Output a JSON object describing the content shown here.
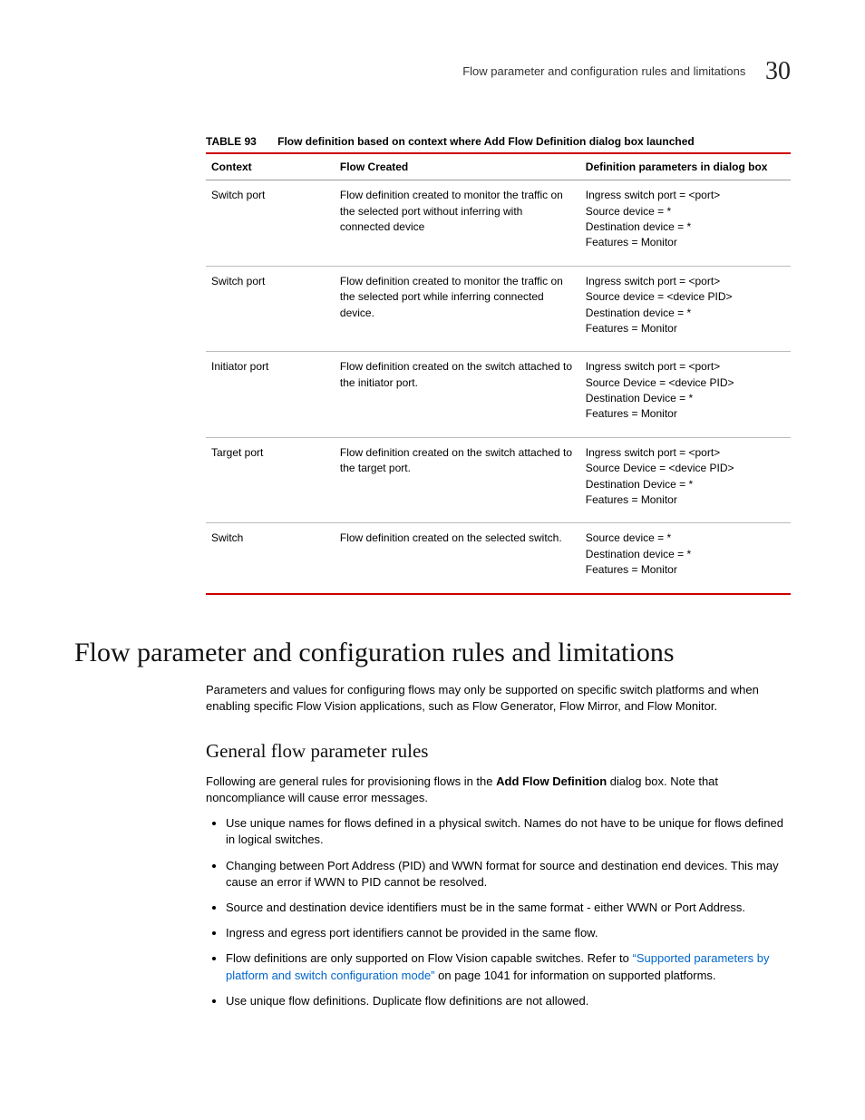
{
  "header": {
    "title": "Flow parameter and configuration rules and limitations",
    "chapnum": "30"
  },
  "table": {
    "label": "TABLE 93",
    "caption": "Flow definition based on context where Add Flow Definition dialog box launched",
    "headers": {
      "context": "Context",
      "flow": "Flow Created",
      "def": "Definition parameters in dialog box"
    },
    "rows": [
      {
        "context": "Switch port",
        "flow": "Flow definition created to monitor the traffic on the selected port without inferring with connected device",
        "def": [
          "Ingress switch port = <port>",
          "Source device = *",
          "Destination device = *",
          "Features = Monitor"
        ]
      },
      {
        "context": "Switch port",
        "flow": "Flow definition created to monitor the traffic on the selected port while inferring connected device.",
        "def": [
          "Ingress switch port = <port>",
          "Source device = <device PID>",
          "Destination device = *",
          "Features = Monitor"
        ]
      },
      {
        "context": "Initiator port",
        "flow": "Flow definition created on the switch attached to the initiator port.",
        "def": [
          "Ingress switch port = <port>",
          "Source Device = <device PID>",
          "Destination Device = *",
          "Features = Monitor"
        ]
      },
      {
        "context": "Target port",
        "flow": "Flow definition created on the switch attached to the target port.",
        "def": [
          "Ingress switch port = <port>",
          "Source Device = <device PID>",
          "Destination Device = *",
          "Features = Monitor"
        ]
      },
      {
        "context": "Switch",
        "flow": "Flow definition created on the selected switch.",
        "def": [
          "Source device = *",
          "Destination device = *",
          "Features = Monitor"
        ]
      }
    ]
  },
  "section": {
    "heading": "Flow parameter and configuration rules and limitations",
    "intro": "Parameters and values for configuring flows may only be supported on specific switch platforms and when enabling specific Flow Vision applications, such as Flow Generator, Flow Mirror, and Flow Monitor."
  },
  "subsection": {
    "heading": "General flow parameter rules",
    "intro_a": "Following are general rules for provisioning flows in the ",
    "intro_bold": "Add Flow Definition",
    "intro_b": " dialog box. Note that noncompliance will cause error messages.",
    "bullets": {
      "b0": "Use unique names for flows defined in a physical switch. Names do not have to be unique for flows defined in logical switches.",
      "b1": "Changing between Port Address (PID) and WWN format for source and destination end devices. This may cause an error if WWN to PID cannot be resolved.",
      "b2": "Source and destination device identifiers must be in the same format - either WWN or Port Address.",
      "b3": "Ingress and egress port identifiers cannot be provided in the same flow.",
      "b4_a": "Flow definitions are only supported on Flow Vision capable switches. Refer to ",
      "b4_link": "“Supported parameters by platform and switch configuration mode”",
      "b4_b": " on page 1041 for information on supported platforms.",
      "b5": "Use unique flow definitions. Duplicate flow definitions are not allowed."
    }
  }
}
